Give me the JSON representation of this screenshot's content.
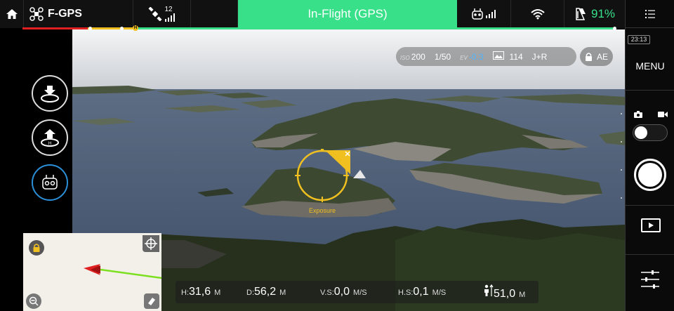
{
  "topbar": {
    "flight_mode": "F-GPS",
    "gps_satellites": "12",
    "status": "In-Flight (GPS)",
    "battery_percent": "91%"
  },
  "camera": {
    "iso_label": "ISO",
    "iso": "200",
    "shutter": "1/50",
    "ev_label": "EV",
    "ev": "-0.3",
    "photos_remaining": "114",
    "format": "J+R",
    "ae_lock": "AE",
    "exposure_label": "Exposure"
  },
  "rightpanel": {
    "time": "23:13",
    "menu": "MENU"
  },
  "telemetry": {
    "h_label": "H:",
    "h_value": "31,6",
    "h_unit": "M",
    "d_label": "D:",
    "d_value": "56,2",
    "d_unit": "M",
    "vs_label": "V.S:",
    "vs_value": "0,0",
    "vs_unit": "M/S",
    "hs_label": "H.S:",
    "hs_value": "0,1",
    "hs_unit": "M/S",
    "alt_value": "51,0",
    "alt_unit": "M"
  },
  "icons": {
    "home": "home-icon",
    "drone": "drone-icon",
    "satellite": "satellite-icon",
    "remote": "remote-controller-icon",
    "wifi": "wifi-icon",
    "battery": "battery-icon",
    "takeoff": "auto-takeoff-icon",
    "return_home": "return-to-home-icon",
    "intelligent_mode": "intelligent-flight-icon"
  },
  "colors": {
    "status_green": "#38e08a",
    "exposure_yellow": "#f0c020",
    "ev_blue": "#4fb4ff",
    "progress_red": "#e02020"
  }
}
